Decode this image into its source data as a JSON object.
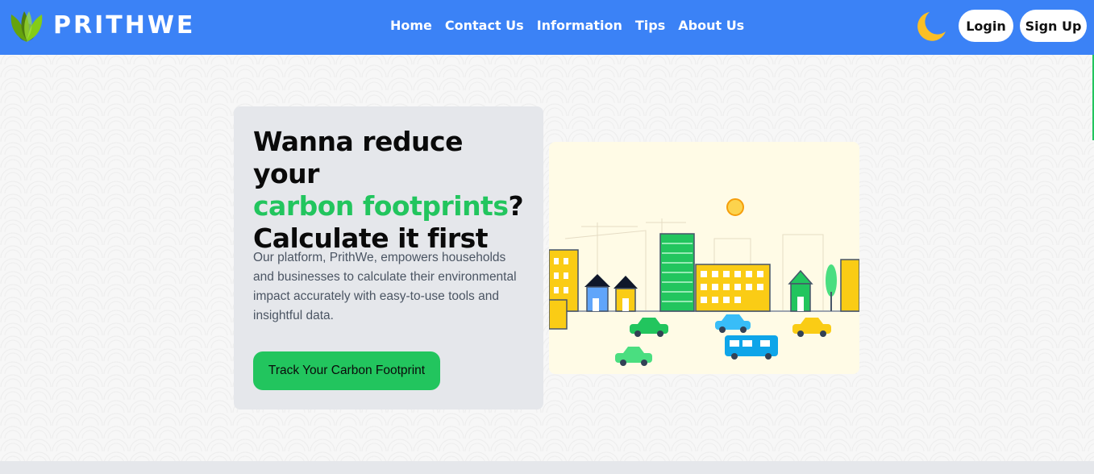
{
  "brand": {
    "name": "PRITHWE"
  },
  "nav": {
    "links": [
      "Home",
      "Contact Us",
      "Information",
      "Tips",
      "About Us"
    ],
    "login_label": "Login",
    "signup_label": "Sign Up"
  },
  "hero": {
    "headline_line1": "Wanna reduce your",
    "headline_highlight": "carbon footprints",
    "headline_punct": "?",
    "headline_line3": "Calculate it first",
    "description": "Our platform, PrithWe, empowers households and businesses to calculate their environmental impact accurately with easy-to-use tools and insightful data.",
    "cta_label": "Track Your Carbon Footprint"
  },
  "icons": {
    "logo": "leaf-globe-icon",
    "theme_toggle": "moon-icon"
  },
  "colors": {
    "navbar": "#3b82f6",
    "accent_green": "#22c55e",
    "card_bg": "#e5e7eb",
    "moon": "#fbbf24"
  }
}
